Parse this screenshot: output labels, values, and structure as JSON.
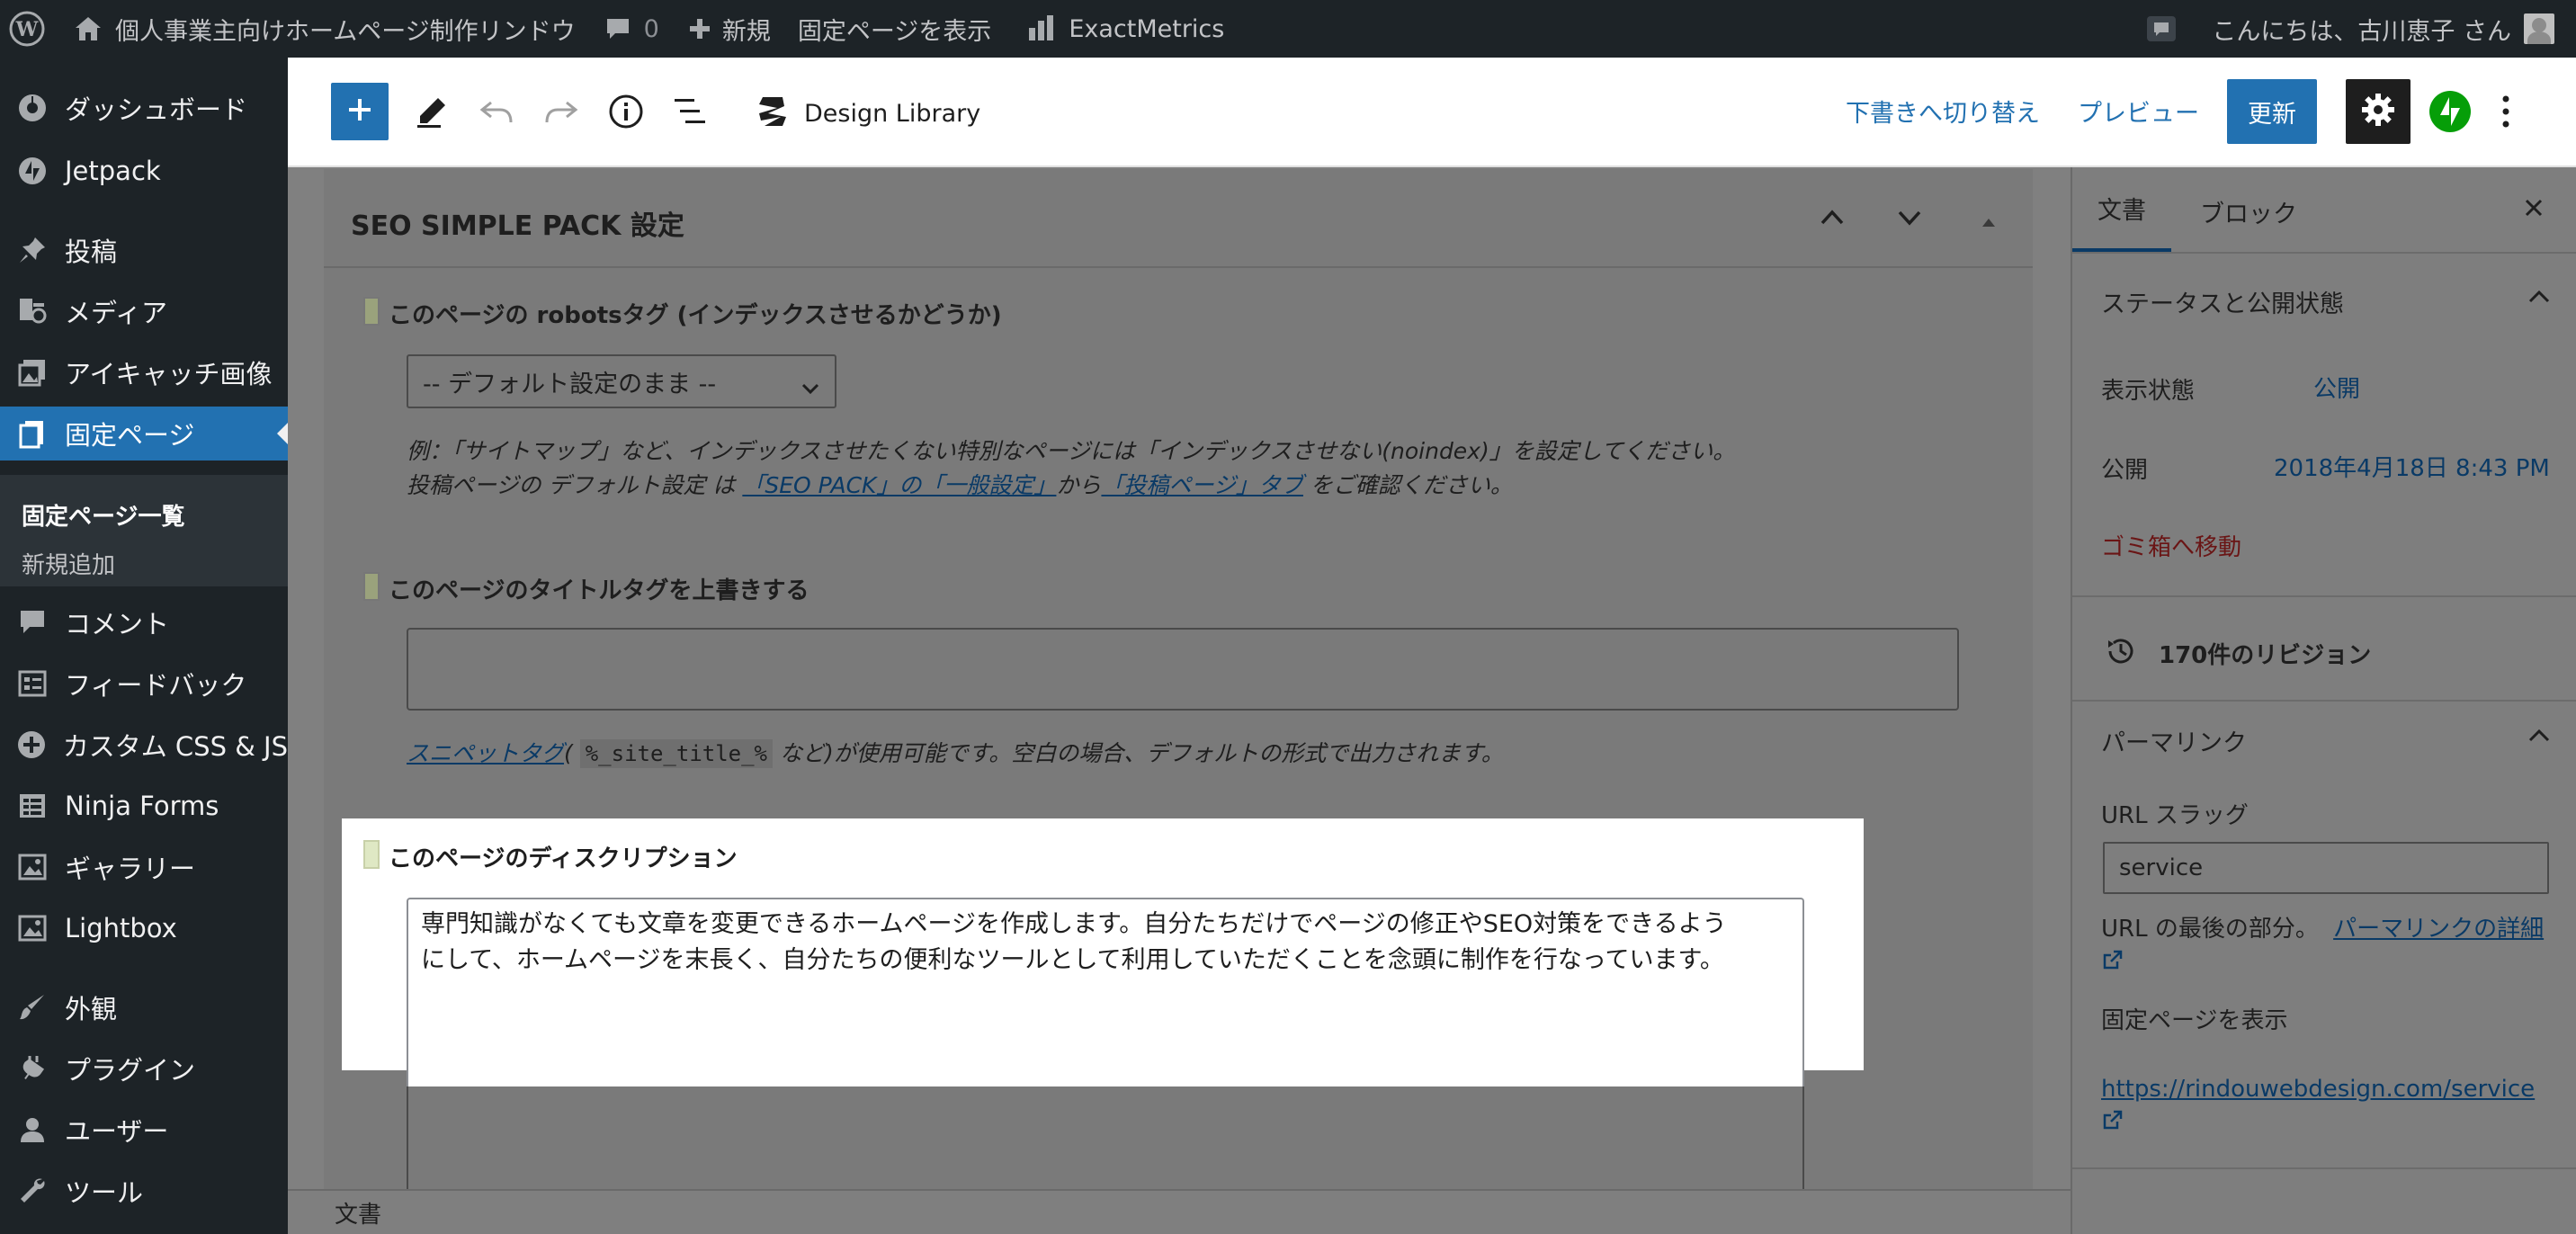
{
  "admin_bar": {
    "site_name": "個人事業主向けホームページ制作リンドウ",
    "comments_count": "0",
    "new_label": "新規",
    "view_page_label": "固定ページを表示",
    "exactmetrics_label": "ExactMetrics",
    "greeting": "こんにちは、古川恵子 さん"
  },
  "sidebar": {
    "items": [
      {
        "label": "ダッシュボード",
        "icon": "dashboard-icon"
      },
      {
        "label": "Jetpack",
        "icon": "jetpack-icon"
      },
      {
        "label": "投稿",
        "icon": "pin-icon"
      },
      {
        "label": "メディア",
        "icon": "media-icon"
      },
      {
        "label": "アイキャッチ画像",
        "icon": "images-icon"
      },
      {
        "label": "固定ページ",
        "icon": "pages-icon"
      },
      {
        "label": "コメント",
        "icon": "comment-icon"
      },
      {
        "label": "フィードバック",
        "icon": "feedback-icon"
      },
      {
        "label": "カスタム CSS & JS",
        "icon": "plus-circle-icon"
      },
      {
        "label": "Ninja Forms",
        "icon": "forms-icon"
      },
      {
        "label": "ギャラリー",
        "icon": "gallery-icon"
      },
      {
        "label": "Lightbox",
        "icon": "lightbox-icon"
      },
      {
        "label": "外観",
        "icon": "brush-icon"
      },
      {
        "label": "プラグイン",
        "icon": "plugin-icon"
      },
      {
        "label": "ユーザー",
        "icon": "user-icon"
      },
      {
        "label": "ツール",
        "icon": "wrench-icon"
      }
    ],
    "submenu": {
      "all_pages": "固定ページ一覧",
      "add_new": "新規追加"
    }
  },
  "toolbar": {
    "design_library": "Design Library",
    "switch_draft": "下書きへ切り替え",
    "preview": "プレビュー",
    "update": "更新"
  },
  "metabox": {
    "title": "SEO SIMPLE PACK 設定",
    "robots": {
      "label": "このページの robotsタグ (インデックスさせるかどうか)",
      "select_value": "-- デフォルト設定のまま --",
      "help_line1": "例：「サイトマップ」など、インデックスさせたくない特別なページには「インデックスさせない(noindex)」を設定してください。",
      "help_line2_prefix": "投稿ページの デフォルト設定 は ",
      "help_link1": "「SEO PACK」の「一般設定」",
      "help_mid": "から",
      "help_link2": "「投稿ページ」タブ",
      "help_suffix": " をご確認ください。"
    },
    "title_tag": {
      "label": "このページのタイトルタグを上書きする",
      "value": "",
      "help_link": "スニペットタグ",
      "help_open": "( ",
      "help_code": "%_site_title_%",
      "help_rest": " など)が使用可能です。空白の場合、デフォルトの形式で出力されます。"
    },
    "description": {
      "label": "このページのディスクリプション",
      "line1": "専門知識がなくても文章を変更できるホームページを作成します。自分たちだけでページの修正やSEO対策をできるよう",
      "line2": "にして、ホームページを末長く、自分たちの便利なツールとして利用していただくことを念頭に制作を行なっています。"
    }
  },
  "status_bar": {
    "breadcrumb": "文書"
  },
  "settings": {
    "tab_document": "文書",
    "tab_block": "ブロック",
    "status_heading": "ステータスと公開状態",
    "visibility_label": "表示状態",
    "visibility_value": "公開",
    "publish_label": "公開",
    "publish_value": "2018年4月18日 8:43 PM",
    "trash": "ゴミ箱へ移動",
    "revisions": "170件のリビジョン",
    "permalink_heading": "パーマリンク",
    "url_slug_label": "URL スラッグ",
    "url_slug_value": "service",
    "url_help": "URL の最後の部分。",
    "permalink_link": "パーマリンクの詳細",
    "view_page": "固定ページを表示",
    "page_url": "https://rindouwebdesign.com/service"
  },
  "colors": {
    "admin_dark": "#1d2327",
    "accent_blue": "#2271b1",
    "jetpack_green": "#069e08",
    "trash_red": "#b32d2e"
  }
}
